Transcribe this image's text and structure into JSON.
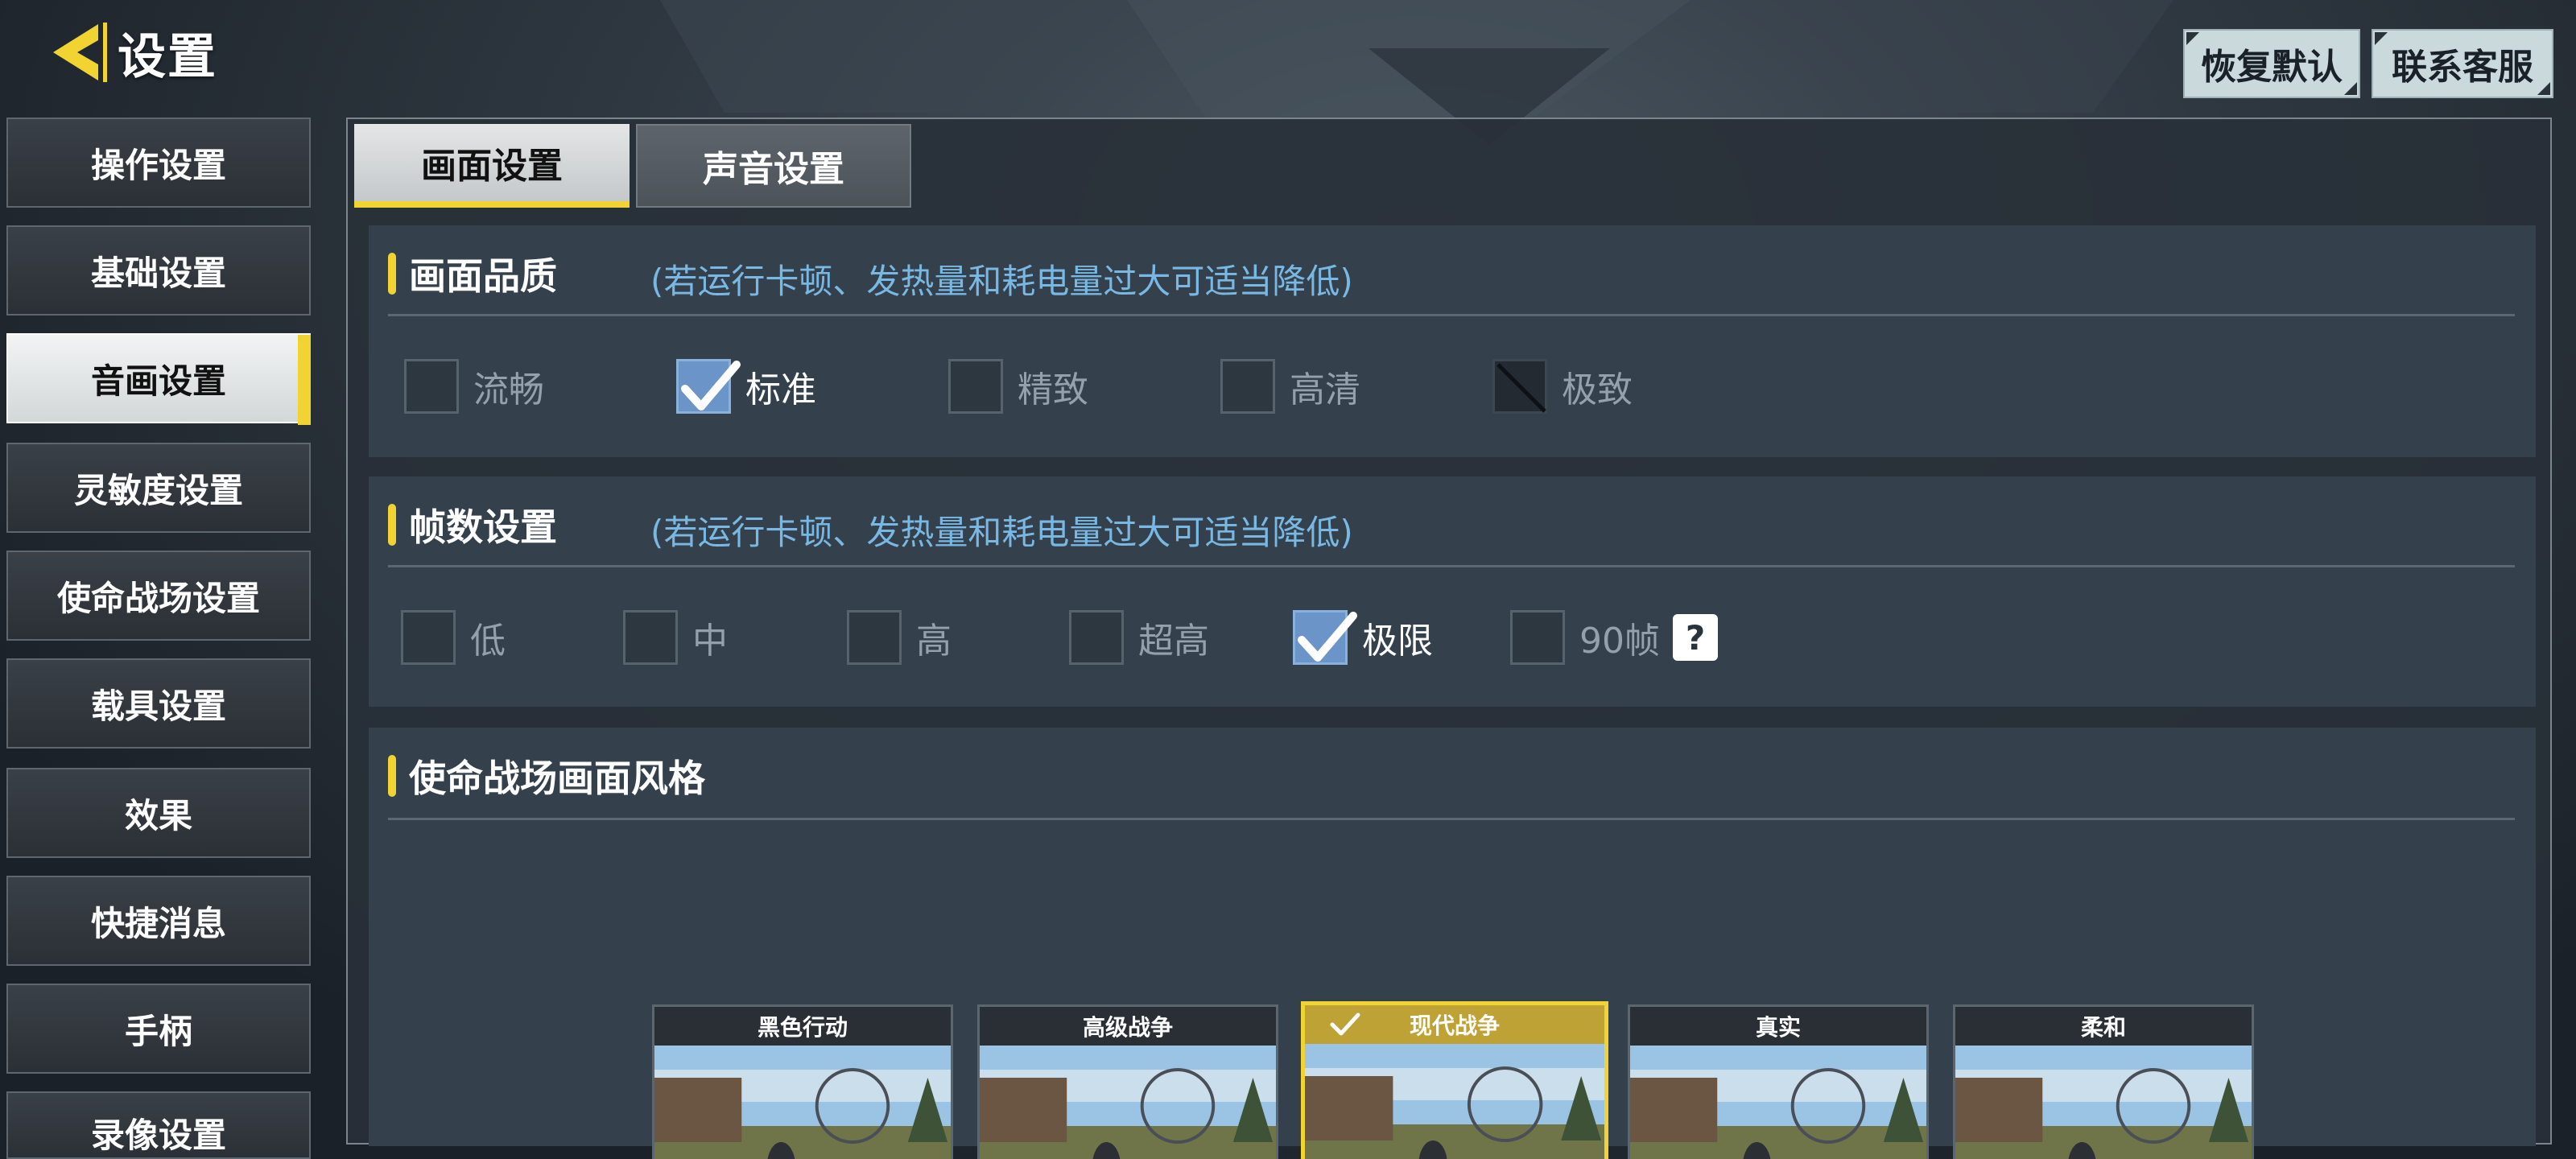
{
  "header": {
    "title": "设置",
    "restore_default": "恢复默认",
    "contact_service": "联系客服"
  },
  "sidebar": {
    "items": [
      {
        "label": "操作设置",
        "active": false
      },
      {
        "label": "基础设置",
        "active": false
      },
      {
        "label": "音画设置",
        "active": true
      },
      {
        "label": "灵敏度设置",
        "active": false
      },
      {
        "label": "使命战场设置",
        "active": false
      },
      {
        "label": "载具设置",
        "active": false
      },
      {
        "label": "效果",
        "active": false
      },
      {
        "label": "快捷消息",
        "active": false
      },
      {
        "label": "手柄",
        "active": false
      },
      {
        "label": "录像设置",
        "active": false
      }
    ]
  },
  "tabs": [
    {
      "label": "画面设置",
      "active": true
    },
    {
      "label": "声音设置",
      "active": false
    }
  ],
  "quality": {
    "title": "画面品质",
    "hint": "(若运行卡顿、发热量和耗电量过大可适当降低)",
    "options": [
      {
        "label": "流畅",
        "checked": false
      },
      {
        "label": "标准",
        "checked": true
      },
      {
        "label": "精致",
        "checked": false
      },
      {
        "label": "高清",
        "checked": false
      },
      {
        "label": "极致",
        "checked": false,
        "locked": true
      }
    ]
  },
  "fps": {
    "title": "帧数设置",
    "hint": "(若运行卡顿、发热量和耗电量过大可适当降低)",
    "options": [
      {
        "label": "低",
        "checked": false
      },
      {
        "label": "中",
        "checked": false
      },
      {
        "label": "高",
        "checked": false
      },
      {
        "label": "超高",
        "checked": false
      },
      {
        "label": "极限",
        "checked": true
      },
      {
        "label": "90帧",
        "checked": false
      }
    ],
    "help": "?"
  },
  "style": {
    "title": "使命战场画面风格",
    "cards": [
      {
        "label": "黑色行动",
        "selected": false
      },
      {
        "label": "高级战争",
        "selected": false
      },
      {
        "label": "现代战争",
        "selected": true
      },
      {
        "label": "真实",
        "selected": false
      },
      {
        "label": "柔和",
        "selected": false
      }
    ]
  },
  "colors": {
    "accent_yellow": "#f1d332",
    "hint_blue": "#79b8e3",
    "checked_blue": "#6b95c8",
    "panel_bg": "#34404b"
  },
  "icons": {
    "back": "chevron-left-icon",
    "check": "checkmark-icon",
    "help": "question-mark-icon"
  }
}
